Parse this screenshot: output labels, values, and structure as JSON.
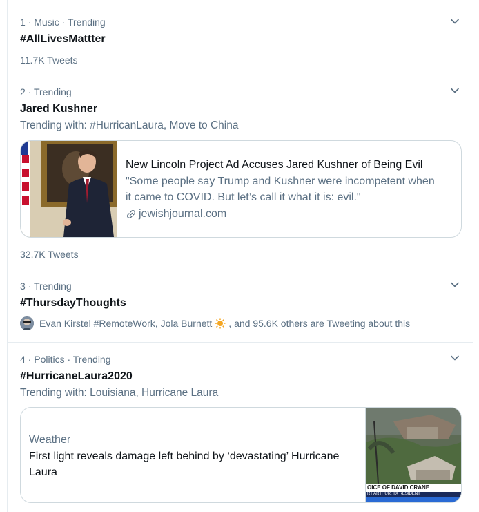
{
  "trends": [
    {
      "meta": "1 · Music · Trending",
      "title": "#AllLivesMattter",
      "tweets": "11.7K Tweets"
    },
    {
      "meta": "2 · Trending",
      "title": "Jared Kushner",
      "trending_with": "Trending with: #HurricanLaura, Move to China",
      "card": {
        "headline": "New Lincoln Project Ad Accuses Jared Kushner of Being Evil",
        "description_line1": "\"Some people say Trump and Kushner were incompetent when",
        "description_line2": "it came to COVID. But let’s call it what it is: evil.\"",
        "domain": "jewishjournal.com"
      },
      "tweets": "32.7K Tweets"
    },
    {
      "meta": "3 · Trending",
      "title": "#ThursdayThoughts",
      "tweeters_prefix": "Evan Kirstel #RemoteWork, Jola Burnett",
      "tweeters_suffix": ", and 95.6K others are Tweeting about this"
    },
    {
      "meta": "4 · Politics · Trending",
      "title": "#HurricaneLaura2020",
      "trending_with": "Trending with: Louisiana, Hurricane Laura",
      "card": {
        "category": "Weather",
        "headline_line1": "First light reveals damage left behind by ‘devastating’ Hurricane",
        "headline_line2": "Laura",
        "image_caption1": "OICE OF DAVID CRANE",
        "image_caption2": "RT ARTHUR, TX RESIDENT"
      }
    }
  ],
  "icons": {
    "more": "chevron-down-icon",
    "link": "link-icon",
    "sun": "sun-emoji-icon"
  }
}
